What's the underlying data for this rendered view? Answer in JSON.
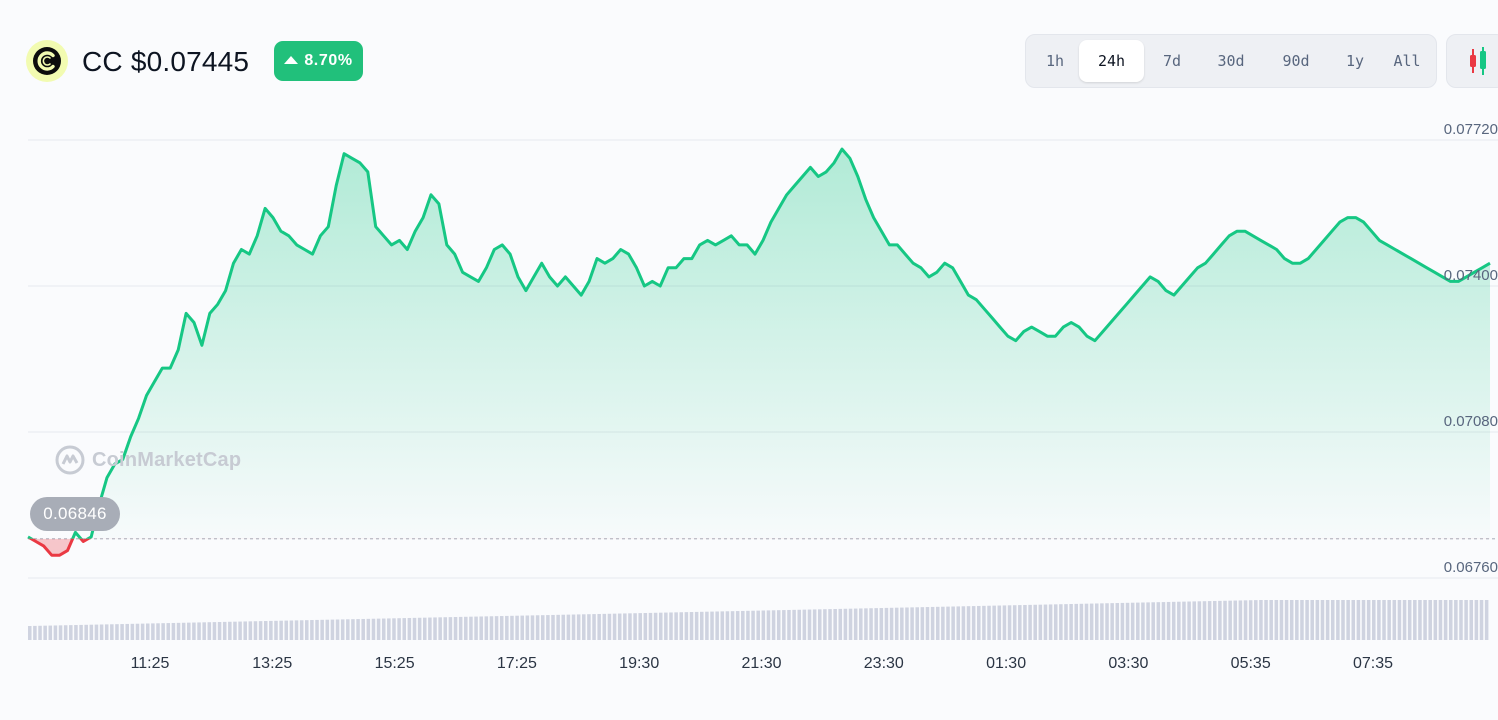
{
  "coin": {
    "title": "CC $0.07445",
    "change_label": "8.70%",
    "change_direction": "up",
    "logo_icon": "cc-logo-icon"
  },
  "ranges": [
    {
      "label": "1h",
      "active": false
    },
    {
      "label": "24h",
      "active": true
    },
    {
      "label": "7d",
      "active": false
    },
    {
      "label": "30d",
      "active": false
    },
    {
      "label": "90d",
      "active": false
    },
    {
      "label": "1y",
      "active": false
    },
    {
      "label": "All",
      "active": false
    }
  ],
  "candle_toggle_icon": "candlestick-icon",
  "watermark_text": "CoinMarketCap",
  "colors": {
    "up": "#16c784",
    "down": "#ea3943",
    "badge": "#21c07b",
    "volume": "#cfd3e0"
  },
  "chart_data": {
    "type": "line",
    "y_ticks": [
      "0.07720",
      "0.07400",
      "0.07080",
      "0.06760"
    ],
    "y_tick_values": [
      0.0772,
      0.074,
      0.0708,
      0.0676
    ],
    "ylim": [
      0.0665,
      0.0775
    ],
    "x_ticks": [
      "11:25",
      "13:25",
      "15:25",
      "17:25",
      "19:30",
      "21:30",
      "23:30",
      "01:30",
      "03:30",
      "05:35",
      "07:35"
    ],
    "start_price": 0.06846,
    "start_price_label": "0.06846",
    "series": [
      {
        "values": [
          0.0685,
          0.0684,
          0.0683,
          0.0681,
          0.0681,
          0.0682,
          0.0686,
          0.0684,
          0.0685,
          0.0692,
          0.0698,
          0.0701,
          0.0702,
          0.0707,
          0.0711,
          0.0716,
          0.0719,
          0.0722,
          0.0722,
          0.0726,
          0.0734,
          0.0732,
          0.0727,
          0.0734,
          0.0736,
          0.0739,
          0.0745,
          0.0748,
          0.0747,
          0.0751,
          0.0757,
          0.0755,
          0.0752,
          0.0751,
          0.0749,
          0.0748,
          0.0747,
          0.0751,
          0.0753,
          0.0762,
          0.0769,
          0.0768,
          0.0767,
          0.0765,
          0.0753,
          0.0751,
          0.0749,
          0.075,
          0.0748,
          0.0752,
          0.0755,
          0.076,
          0.0758,
          0.0749,
          0.0747,
          0.0743,
          0.0742,
          0.0741,
          0.0744,
          0.0748,
          0.0749,
          0.0747,
          0.0742,
          0.0739,
          0.0742,
          0.0745,
          0.0742,
          0.074,
          0.0742,
          0.074,
          0.0738,
          0.0741,
          0.0746,
          0.0745,
          0.0746,
          0.0748,
          0.0747,
          0.0744,
          0.074,
          0.0741,
          0.074,
          0.0744,
          0.0744,
          0.0746,
          0.0746,
          0.0749,
          0.075,
          0.0749,
          0.075,
          0.0751,
          0.0749,
          0.0749,
          0.0747,
          0.075,
          0.0754,
          0.0757,
          0.076,
          0.0762,
          0.0764,
          0.0766,
          0.0764,
          0.0765,
          0.0767,
          0.077,
          0.0768,
          0.0764,
          0.0759,
          0.0755,
          0.0752,
          0.0749,
          0.0749,
          0.0747,
          0.0745,
          0.0744,
          0.0742,
          0.0743,
          0.0745,
          0.0744,
          0.0741,
          0.0738,
          0.0737,
          0.0735,
          0.0733,
          0.0731,
          0.0729,
          0.0728,
          0.073,
          0.0731,
          0.073,
          0.0729,
          0.0729,
          0.0731,
          0.0732,
          0.0731,
          0.0729,
          0.0728,
          0.073,
          0.0732,
          0.0734,
          0.0736,
          0.0738,
          0.074,
          0.0742,
          0.0741,
          0.0739,
          0.0738,
          0.074,
          0.0742,
          0.0744,
          0.0745,
          0.0747,
          0.0749,
          0.0751,
          0.0752,
          0.0752,
          0.0751,
          0.075,
          0.0749,
          0.0748,
          0.0746,
          0.0745,
          0.0745,
          0.0746,
          0.0748,
          0.075,
          0.0752,
          0.0754,
          0.0755,
          0.0755,
          0.0754,
          0.0752,
          0.075,
          0.0749,
          0.0748,
          0.0747,
          0.0746,
          0.0745,
          0.0744,
          0.0743,
          0.0742,
          0.0741,
          0.0741,
          0.0742,
          0.0743,
          0.0744,
          0.0745
        ]
      }
    ],
    "grid": true,
    "legend": "none"
  }
}
